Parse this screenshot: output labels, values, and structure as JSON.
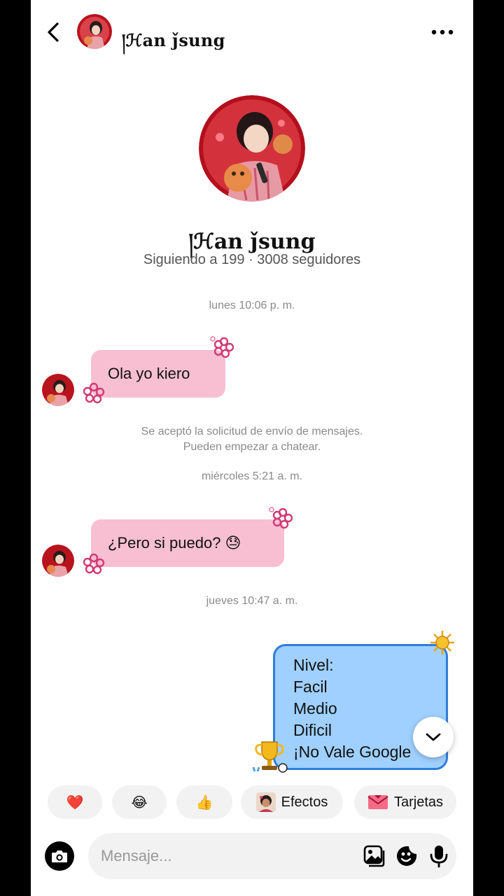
{
  "header": {
    "name": "།ℋan ǰsung"
  },
  "profile": {
    "name": "།ℋan ǰsung",
    "stats": "Siguiendo a 199 · 3008 seguidores"
  },
  "timestamps": {
    "t1": "lunes 10:06 p. m.",
    "t2": "miércoles 5:21 a. m.",
    "t3": "jueves 10:47 a. m."
  },
  "system": {
    "line1": "Se aceptó la solicitud de envío de mensajes.",
    "line2": "Pueden empezar a chatear."
  },
  "messages": {
    "m1": "Ola yo kiero",
    "m2": "¿Pero si puedo? 😓",
    "m3": [
      "Nivel:",
      "Facil",
      "Medio",
      "Dificil",
      "¡No Vale Google"
    ]
  },
  "quick_reactions": [
    {
      "emoji": "❤️",
      "label": ""
    },
    {
      "emoji": "😂",
      "label": ""
    },
    {
      "emoji": "👍",
      "label": ""
    },
    {
      "emoji": "",
      "label": "Efectos"
    },
    {
      "emoji": "",
      "label": "Tarjetas"
    }
  ],
  "composer": {
    "placeholder": "Mensaje..."
  },
  "colors": {
    "pink_bubble": "#f8bfd2",
    "blue_bubble": "#9fd0ff",
    "blue_border": "#2f7ed8"
  },
  "icons": [
    "back-icon",
    "more-icon",
    "camera-icon",
    "gallery-icon",
    "sticker-icon",
    "microphone-icon",
    "chevron-down-icon"
  ]
}
